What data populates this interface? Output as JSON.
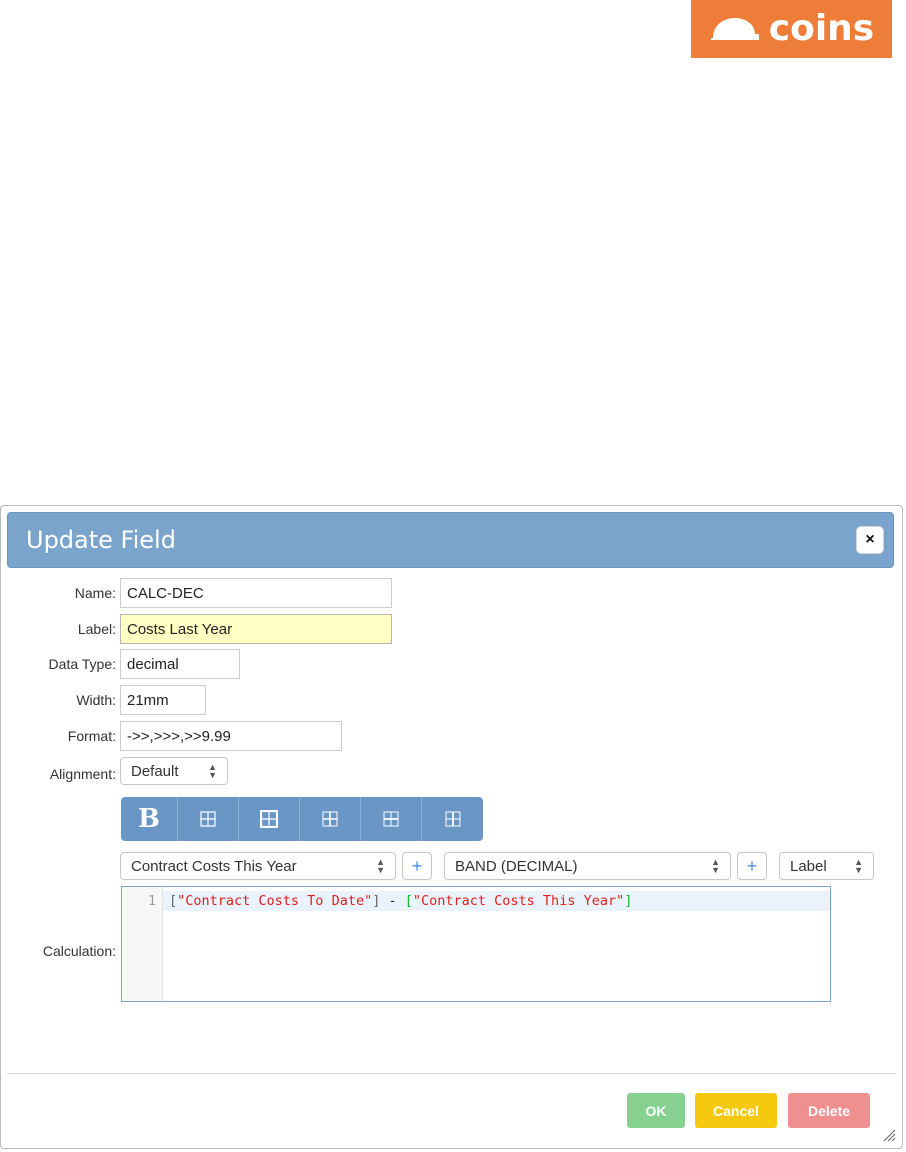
{
  "logo": {
    "text": "coins",
    "color": "#ef7d3a"
  },
  "dialog": {
    "title": "Update Field",
    "close_icon": "×",
    "fields": {
      "name": {
        "label": "Name:",
        "value": "CALC-DEC"
      },
      "label": {
        "label": "Label:",
        "value": "Costs Last Year"
      },
      "data_type": {
        "label": "Data Type:",
        "value": "decimal"
      },
      "width": {
        "label": "Width:",
        "value": "21mm"
      },
      "format": {
        "label": "Format:",
        "value": "->>,>>>,>>9.99"
      },
      "alignment": {
        "label": "Alignment:",
        "value": "Default"
      }
    },
    "toolbar": {
      "bold_label": "B",
      "border_icons": [
        "border-all-icon",
        "border-outer-icon",
        "border-inner-icon",
        "border-horizontal-icon",
        "border-vertical-icon"
      ]
    },
    "calc_row": {
      "field_select": "Contract Costs This Year",
      "band_select": "BAND (DECIMAL)",
      "type_select": "Label",
      "plus": "+"
    },
    "calculation": {
      "label": "Calculation:",
      "line_number": "1",
      "tokens": {
        "open1": "[",
        "str1": "\"Contract Costs To Date\"",
        "close1": "]",
        "op": " - ",
        "open2": "[",
        "str2": "\"Contract Costs This Year\"",
        "close2": "]"
      }
    },
    "buttons": {
      "ok": "OK",
      "cancel": "Cancel",
      "delete": "Delete"
    },
    "colors": {
      "header": "#7aa4cc",
      "toolbar": "#6a96c6",
      "ok": "#86d18f",
      "cancel": "#f6c90e",
      "delete": "#f08f8f",
      "label_highlight": "#ffffc4"
    }
  }
}
